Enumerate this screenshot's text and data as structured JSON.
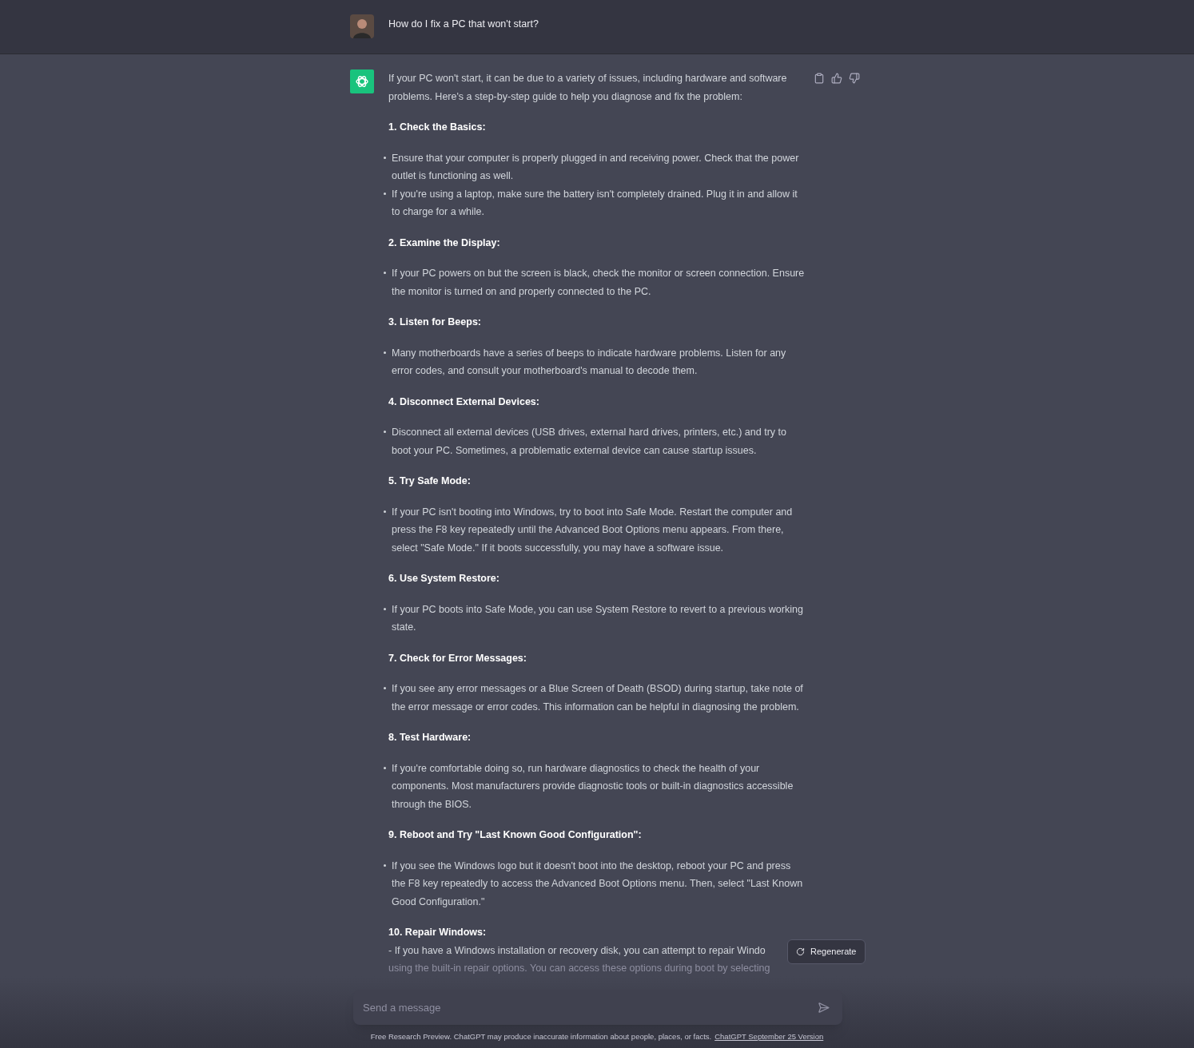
{
  "user": {
    "message": "How do I fix a PC that won't start?"
  },
  "assistant": {
    "intro": "If your PC won't start, it can be due to a variety of issues, including hardware and software problems. Here's a step-by-step guide to help you diagnose and fix the problem:",
    "sections": [
      {
        "heading": "1. Check the Basics:",
        "bullets": [
          "Ensure that your computer is properly plugged in and receiving power. Check that the power outlet is functioning as well.",
          "If you're using a laptop, make sure the battery isn't completely drained. Plug it in and allow it to charge for a while."
        ]
      },
      {
        "heading": "2. Examine the Display:",
        "bullets": [
          "If your PC powers on but the screen is black, check the monitor or screen connection. Ensure the monitor is turned on and properly connected to the PC."
        ]
      },
      {
        "heading": "3. Listen for Beeps:",
        "bullets": [
          "Many motherboards have a series of beeps to indicate hardware problems. Listen for any error codes, and consult your motherboard's manual to decode them."
        ]
      },
      {
        "heading": "4. Disconnect External Devices:",
        "bullets": [
          "Disconnect all external devices (USB drives, external hard drives, printers, etc.) and try to boot your PC. Sometimes, a problematic external device can cause startup issues."
        ]
      },
      {
        "heading": "5. Try Safe Mode:",
        "bullets": [
          "If your PC isn't booting into Windows, try to boot into Safe Mode. Restart the computer and press the F8 key repeatedly until the Advanced Boot Options menu appears. From there, select \"Safe Mode.\" If it boots successfully, you may have a software issue."
        ]
      },
      {
        "heading": "6. Use System Restore:",
        "bullets": [
          "If your PC boots into Safe Mode, you can use System Restore to revert to a previous working state."
        ]
      },
      {
        "heading": "7. Check for Error Messages:",
        "bullets": [
          "If you see any error messages or a Blue Screen of Death (BSOD) during startup, take note of the error message or error codes. This information can be helpful in diagnosing the problem."
        ]
      },
      {
        "heading": "8. Test Hardware:",
        "bullets": [
          "If you're comfortable doing so, run hardware diagnostics to check the health of your components. Most manufacturers provide diagnostic tools or built-in diagnostics accessible through the BIOS."
        ]
      },
      {
        "heading": "9. Reboot and Try \"Last Known Good Configuration\":",
        "bullets": [
          "If you see the Windows logo but it doesn't boot into the desktop, reboot your PC and press the F8 key repeatedly to access the Advanced Boot Options menu. Then, select \"Last Known Good Configuration.\""
        ]
      },
      {
        "heading": "10. Repair Windows:",
        "lines": [
          "- If you have a Windows installation or recovery disk, you can attempt to repair Windo",
          "using the built-in repair options. You can access these options during boot by selecting"
        ]
      }
    ]
  },
  "regenerate": "Regenerate",
  "composer": {
    "placeholder": "Send a message"
  },
  "footer": {
    "text": "Free Research Preview. ChatGPT may produce inaccurate information about people, places, or facts.",
    "link": "ChatGPT September 25 Version"
  }
}
